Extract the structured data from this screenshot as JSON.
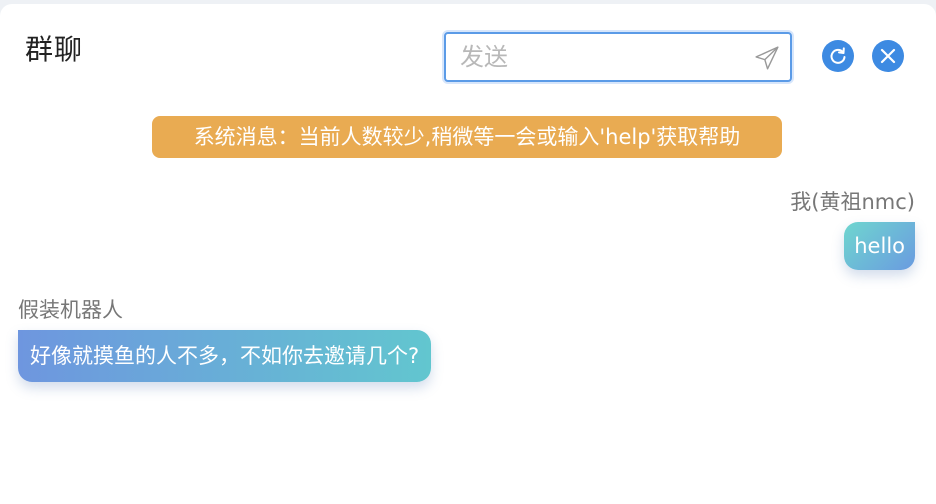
{
  "header": {
    "title": "群聊"
  },
  "send": {
    "placeholder": "发送"
  },
  "icons": {
    "send": "paper-plane-icon",
    "refresh": "refresh-icon",
    "close": "close-icon"
  },
  "colors": {
    "accent": "#3d8ae2",
    "system_msg_bg": "#e9ab52"
  },
  "messages": [
    {
      "type": "system",
      "text": "系统消息：当前人数较少,稍微等一会或输入'help'获取帮助"
    },
    {
      "type": "self",
      "sender": "我(黄祖nmc)",
      "text": "hello"
    },
    {
      "type": "other",
      "sender": "假装机器人",
      "text": "好像就摸鱼的人不多，不如你去邀请几个?"
    }
  ]
}
